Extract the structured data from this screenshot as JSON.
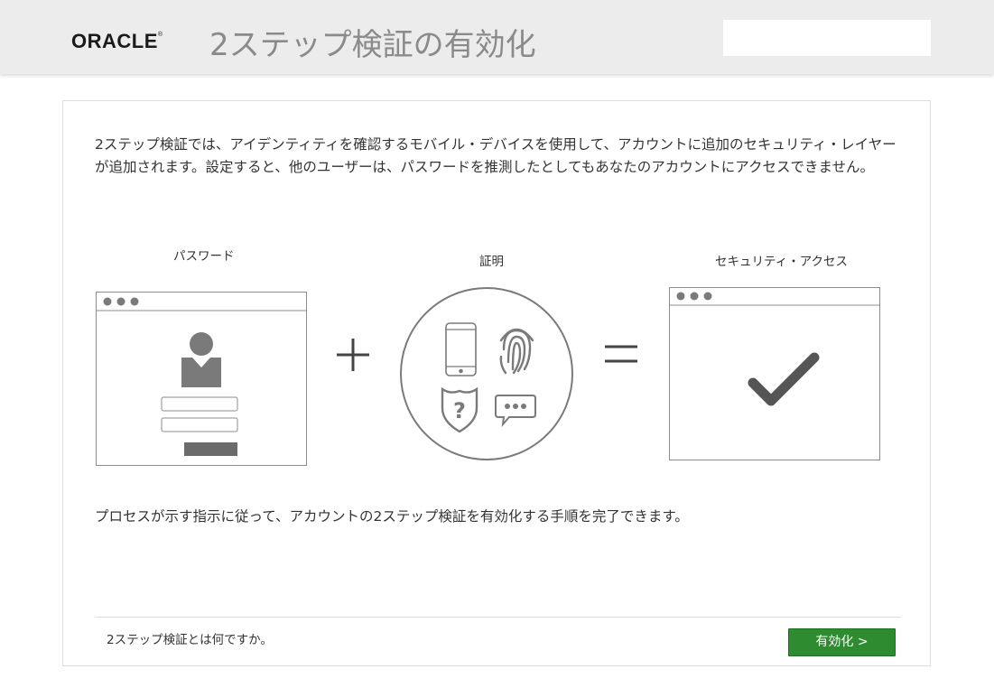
{
  "header": {
    "logo_text": "ORACLE",
    "logo_mark": "®",
    "title": "2ステップ検証の有効化"
  },
  "main": {
    "intro": "2ステップ検証では、アイデンティティを確認するモバイル・デバイスを使用して、アカウントに追加のセキュリティ・レイヤーが追加されます。設定すると、他のユーザーは、パスワードを推測したとしてもあなたのアカウントにアクセスできません。",
    "steps": [
      {
        "label": "パスワード",
        "icon": "password-login-window-icon"
      },
      {
        "label": "証明",
        "icon": "verification-methods-icon"
      },
      {
        "label": "セキュリティ・アクセス",
        "icon": "secure-access-check-icon"
      }
    ],
    "operators": {
      "plus": "+",
      "equals": "="
    },
    "process_note": "プロセスが示す指示に従って、アカウントの2ステップ検証を有効化する手順を完了できます。"
  },
  "footer": {
    "help_link": "2ステップ検証とは何ですか。",
    "enable_button": "有効化 >"
  },
  "colors": {
    "header_bg": "#ececec",
    "button_green": "#2e8b2f",
    "icon_gray": "#777777"
  }
}
